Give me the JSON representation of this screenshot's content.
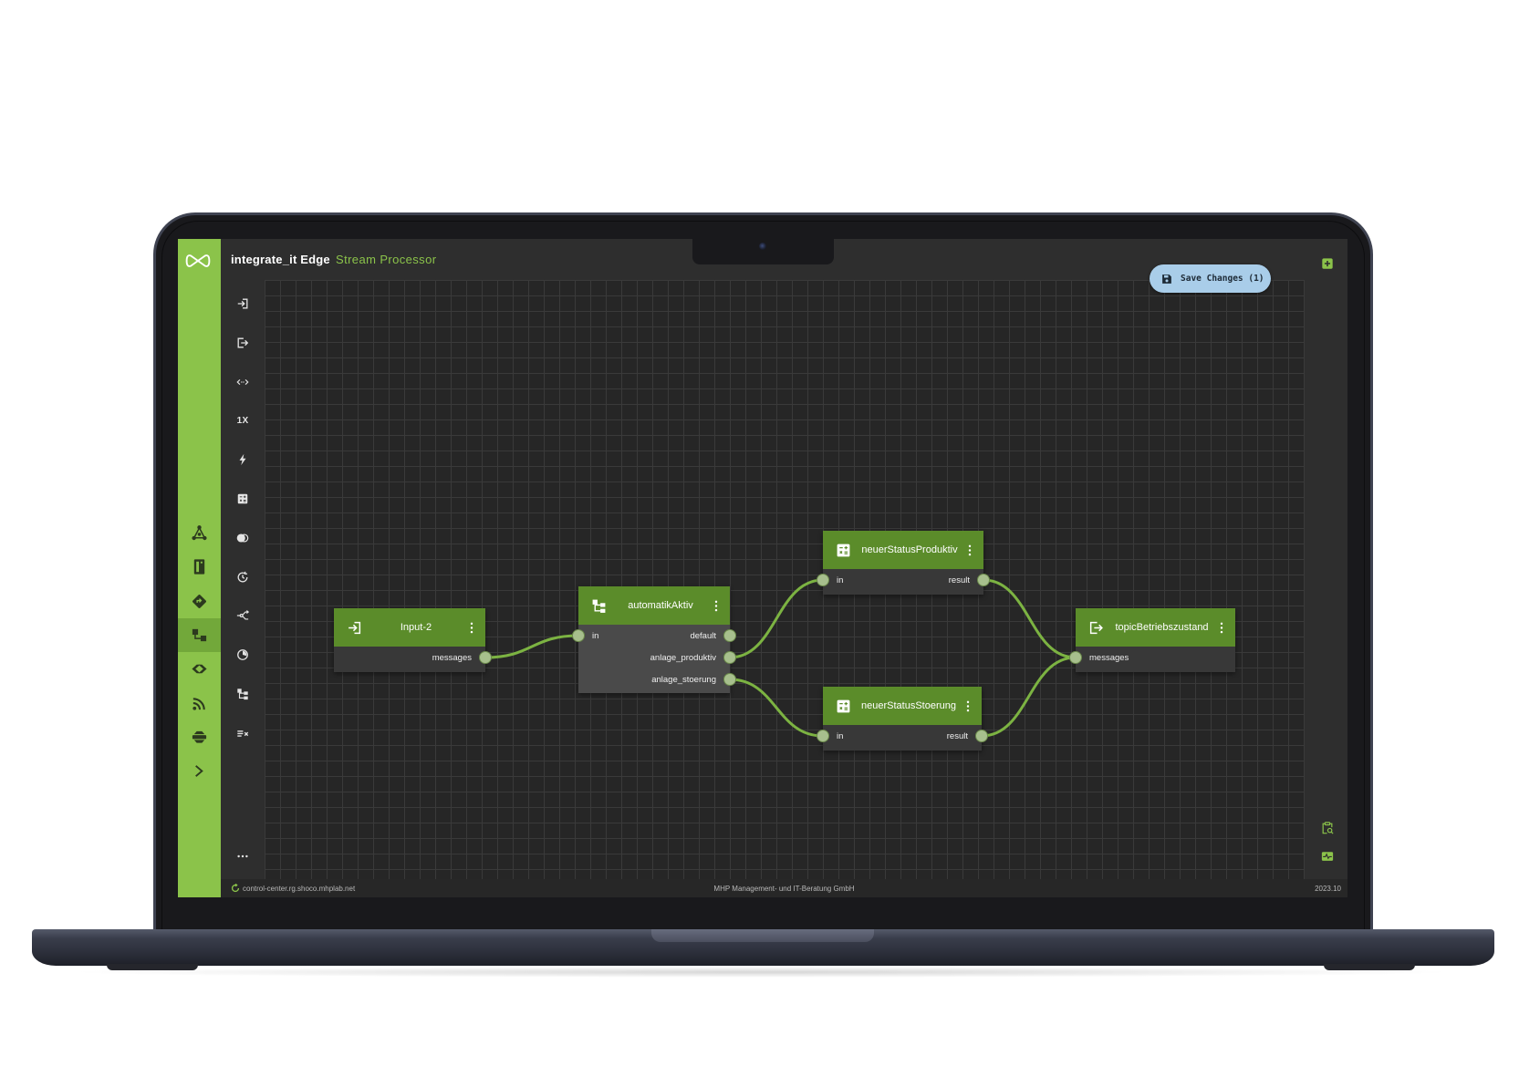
{
  "app": {
    "brand": "integrate_it Edge",
    "module": "Stream Processor",
    "accent_color": "#8bc34a",
    "node_header_color": "#5b8c2a"
  },
  "save_button": {
    "label": "Save Changes (1)",
    "icon": "save-icon",
    "color": "#a9cde9"
  },
  "sidebar": {
    "items": [
      {
        "icon": "hub-icon"
      },
      {
        "icon": "server-icon"
      },
      {
        "icon": "directions-icon"
      },
      {
        "icon": "flow-icon",
        "selected": true
      },
      {
        "icon": "connector-icon"
      },
      {
        "icon": "rss-icon"
      },
      {
        "icon": "database-icon"
      },
      {
        "icon": "terminal-icon"
      }
    ]
  },
  "toolbar": {
    "items": [
      {
        "icon": "input-icon"
      },
      {
        "icon": "output-icon"
      },
      {
        "icon": "mapping-icon"
      },
      {
        "icon": "once-icon",
        "label": "1X"
      },
      {
        "icon": "trigger-icon"
      },
      {
        "icon": "calculator-icon"
      },
      {
        "icon": "merge-icon"
      },
      {
        "icon": "timer-icon"
      },
      {
        "icon": "split-icon"
      },
      {
        "icon": "gauge-icon"
      },
      {
        "icon": "tree-icon"
      },
      {
        "icon": "filter-icon"
      }
    ],
    "more_icon": "more-icon"
  },
  "right_panel": {
    "icons": [
      "add-box-icon",
      "clipboard-search-icon",
      "monitor-pulse-icon"
    ]
  },
  "nodes": [
    {
      "id": "input_2",
      "title": "Input-2",
      "icon": "input-icon",
      "inputs": [],
      "outputs": [
        "messages"
      ]
    },
    {
      "id": "automatik",
      "title": "automatikAktiv",
      "icon": "tree-icon",
      "inputs": [
        "in"
      ],
      "outputs": [
        "default",
        "anlage_produktiv",
        "anlage_stoerung"
      ]
    },
    {
      "id": "produktiv",
      "title": "neuerStatusProduktiv",
      "icon": "calculator-icon",
      "inputs": [
        "in"
      ],
      "outputs": [
        "result"
      ]
    },
    {
      "id": "stoerung",
      "title": "neuerStatusStoerung",
      "icon": "calculator-icon",
      "inputs": [
        "in"
      ],
      "outputs": [
        "result"
      ]
    },
    {
      "id": "topic",
      "title": "topicBetriebszustand",
      "icon": "output-icon",
      "inputs": [
        "messages"
      ],
      "outputs": []
    }
  ],
  "edges": [
    {
      "from": "input_2.messages",
      "to": "automatik.in"
    },
    {
      "from": "automatik.anlage_produktiv",
      "to": "produktiv.in"
    },
    {
      "from": "automatik.anlage_stoerung",
      "to": "stoerung.in"
    },
    {
      "from": "produktiv.result",
      "to": "topic.messages"
    },
    {
      "from": "stoerung.result",
      "to": "topic.messages"
    }
  ],
  "footer": {
    "status_icon": "sync-status-icon",
    "host": "control-center.rg.shoco.mhplab.net",
    "company": "MHP Management- und IT-Beratung GmbH",
    "version": "2023.10"
  }
}
